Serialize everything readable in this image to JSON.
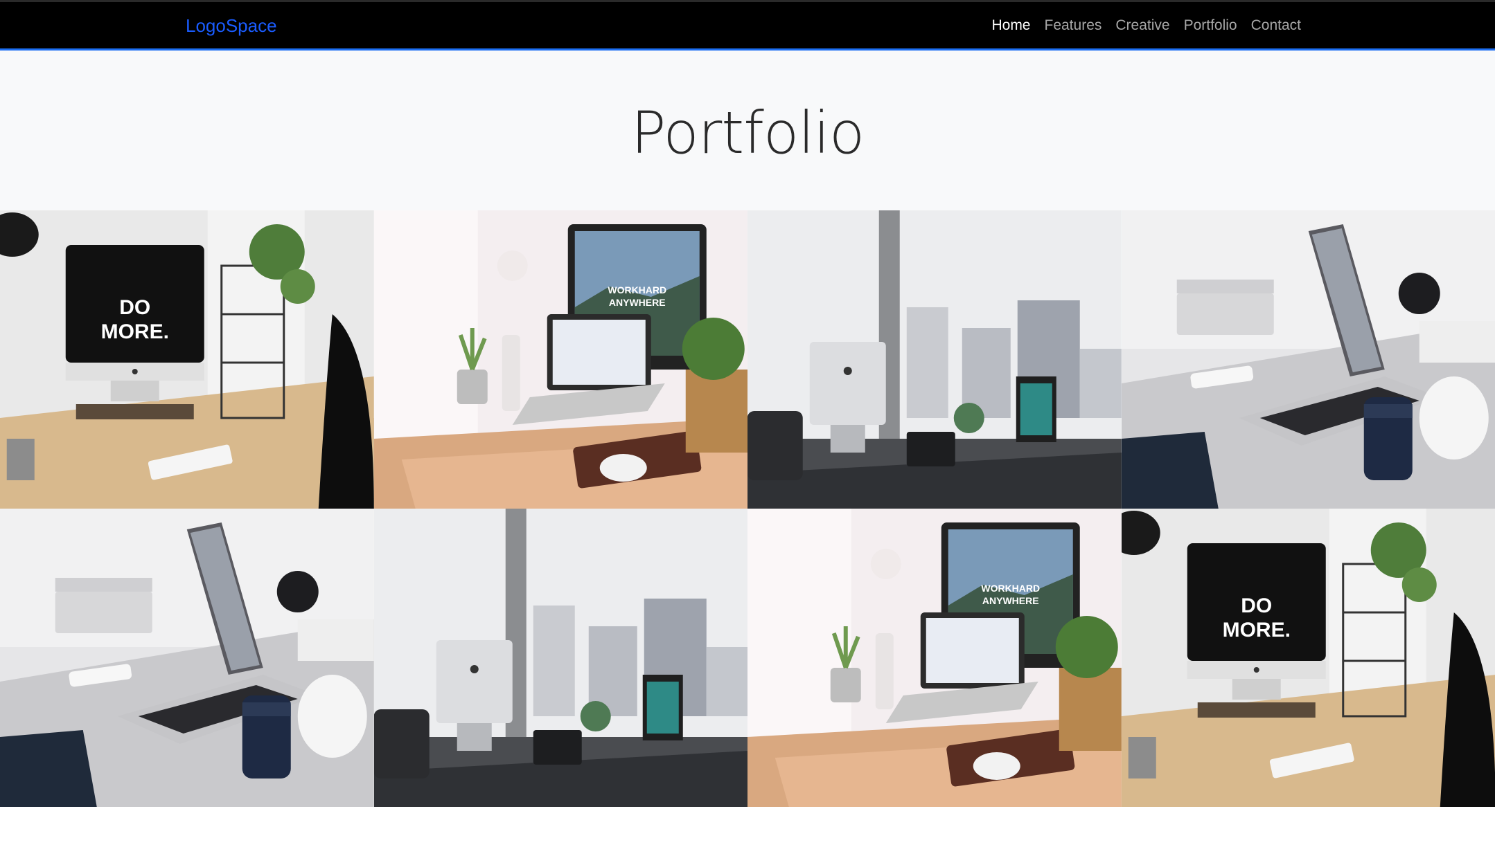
{
  "navbar": {
    "brand": "LogoSpace",
    "links": [
      {
        "label": "Home",
        "active": true
      },
      {
        "label": "Features",
        "active": false
      },
      {
        "label": "Creative",
        "active": false
      },
      {
        "label": "Portfolio",
        "active": false
      },
      {
        "label": "Contact",
        "active": false
      }
    ],
    "accent_color": "#1c6ef2",
    "brand_color": "#1a5cff"
  },
  "hero": {
    "title": "Portfolio"
  },
  "portfolio": {
    "items": [
      {
        "scene": "imac-do-more",
        "screen_text": [
          "DO",
          "MORE."
        ]
      },
      {
        "scene": "imac-workhard",
        "screen_text": [
          "WORKHARD",
          "ANYWHERE"
        ]
      },
      {
        "scene": "imac-window-city",
        "screen_text": []
      },
      {
        "scene": "laptop-grey-desk",
        "screen_text": []
      },
      {
        "scene": "laptop-grey-desk",
        "screen_text": []
      },
      {
        "scene": "imac-window-city",
        "screen_text": []
      },
      {
        "scene": "imac-workhard",
        "screen_text": [
          "WORKHARD",
          "ANYWHERE"
        ]
      },
      {
        "scene": "imac-do-more",
        "screen_text": [
          "DO",
          "MORE."
        ]
      }
    ]
  }
}
